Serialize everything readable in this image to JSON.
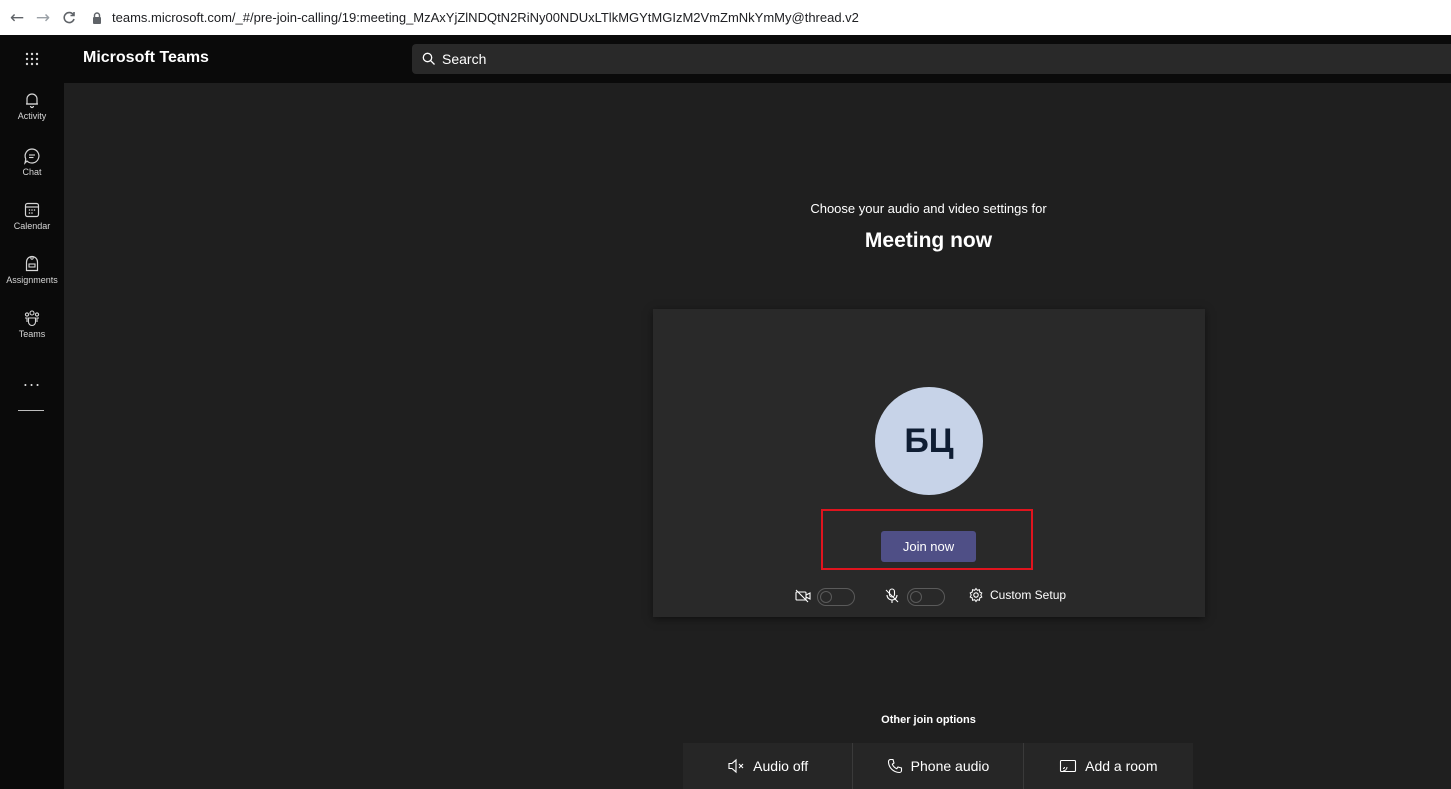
{
  "browser": {
    "url": "teams.microsoft.com/_#/pre-join-calling/19:meeting_MzAxYjZlNDQtN2RiNy00NDUxLTlkMGYtMGIzM2VmZmNkYmMy@thread.v2"
  },
  "header": {
    "app_title": "Microsoft Teams",
    "search_placeholder": "Search"
  },
  "rail": {
    "items": [
      {
        "label": "Activity",
        "icon": "bell-icon"
      },
      {
        "label": "Chat",
        "icon": "chat-icon"
      },
      {
        "label": "Calendar",
        "icon": "calendar-icon"
      },
      {
        "label": "Assignments",
        "icon": "assignments-icon"
      },
      {
        "label": "Teams",
        "icon": "teams-icon"
      }
    ],
    "more": "..."
  },
  "prejoin": {
    "prompt": "Choose your audio and video settings for",
    "meeting_title": "Meeting now",
    "avatar_initials": "БЦ",
    "join_label": "Join now",
    "camera_on": false,
    "mic_on": false,
    "custom_setup_label": "Custom Setup"
  },
  "other_options": {
    "label": "Other join options",
    "items": [
      {
        "label": "Audio off",
        "icon": "speaker-off-icon"
      },
      {
        "label": "Phone audio",
        "icon": "phone-icon"
      },
      {
        "label": "Add a room",
        "icon": "cast-icon"
      }
    ]
  },
  "colors": {
    "highlight": "#e0141e",
    "join_button": "#4f4f86",
    "avatar_bg": "#c7d3e8"
  }
}
